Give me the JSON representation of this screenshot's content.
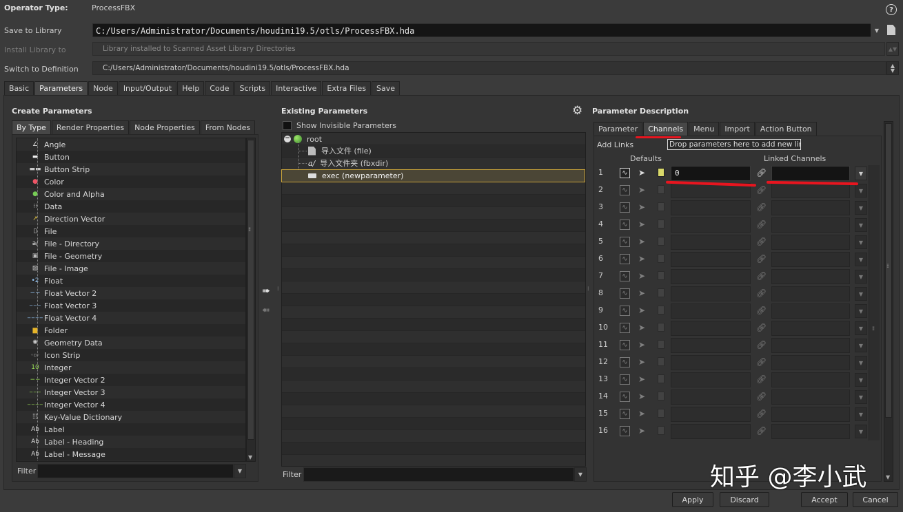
{
  "header": {
    "operator_type_label": "Operator Type:",
    "operator_type_value": "ProcessFBX",
    "save_to_library_label": "Save to Library",
    "save_to_library_value": "C:/Users/Administrator/Documents/houdini19.5/otls/ProcessFBX.hda",
    "install_library_label": "Install Library to",
    "install_library_value": "Library installed to Scanned Asset Library Directories",
    "switch_definition_label": "Switch to Definition",
    "switch_definition_value": "C:/Users/Administrator/Documents/houdini19.5/otls/ProcessFBX.hda",
    "help_icon": "question-circle-icon"
  },
  "main_tabs": [
    "Basic",
    "Parameters",
    "Node",
    "Input/Output",
    "Help",
    "Code",
    "Scripts",
    "Interactive",
    "Extra Files",
    "Save"
  ],
  "main_tab_active": "Parameters",
  "create_parameters": {
    "title": "Create Parameters",
    "tabs": [
      "By Type",
      "Render Properties",
      "Node Properties",
      "From Nodes"
    ],
    "active_tab": "By Type",
    "items": [
      {
        "label": "Angle",
        "icon": "angle-icon"
      },
      {
        "label": "Button",
        "icon": "button-icon"
      },
      {
        "label": "Button Strip",
        "icon": "button-strip-icon"
      },
      {
        "label": "Color",
        "icon": "color-icon"
      },
      {
        "label": "Color and Alpha",
        "icon": "color-alpha-icon"
      },
      {
        "label": "Data",
        "icon": "data-icon"
      },
      {
        "label": "Direction Vector",
        "icon": "direction-vector-icon"
      },
      {
        "label": "File",
        "icon": "file-icon"
      },
      {
        "label": "File - Directory",
        "icon": "directory-icon"
      },
      {
        "label": "File - Geometry",
        "icon": "geometry-file-icon"
      },
      {
        "label": "File - Image",
        "icon": "image-file-icon"
      },
      {
        "label": "Float",
        "icon": "float-icon"
      },
      {
        "label": "Float Vector 2",
        "icon": "float-vector2-icon"
      },
      {
        "label": "Float Vector 3",
        "icon": "float-vector3-icon"
      },
      {
        "label": "Float Vector 4",
        "icon": "float-vector4-icon"
      },
      {
        "label": "Folder",
        "icon": "folder-icon"
      },
      {
        "label": "Geometry Data",
        "icon": "geometry-data-icon"
      },
      {
        "label": "Icon Strip",
        "icon": "icon-strip-icon"
      },
      {
        "label": "Integer",
        "icon": "integer-icon"
      },
      {
        "label": "Integer Vector 2",
        "icon": "integer-vector2-icon"
      },
      {
        "label": "Integer Vector 3",
        "icon": "integer-vector3-icon"
      },
      {
        "label": "Integer Vector 4",
        "icon": "integer-vector4-icon"
      },
      {
        "label": "Key-Value Dictionary",
        "icon": "dictionary-icon"
      },
      {
        "label": "Label",
        "icon": "label-icon"
      },
      {
        "label": "Label - Heading",
        "icon": "label-heading-icon"
      },
      {
        "label": "Label - Message",
        "icon": "label-message-icon"
      }
    ],
    "filter_label": "Filter"
  },
  "existing_parameters": {
    "title": "Existing Parameters",
    "show_invisible_label": "Show Invisible Parameters",
    "root_label": "root",
    "children": [
      {
        "label": "导入文件 (file)",
        "icon": "geometry-file-icon"
      },
      {
        "label": "导入文件夹 (fbxdir)",
        "icon": "directory-icon"
      },
      {
        "label": "exec (newparameter)",
        "icon": "button-icon"
      }
    ],
    "selected_index": 2,
    "filter_label": "Filter"
  },
  "parameter_description": {
    "title": "Parameter Description",
    "tabs": [
      "Parameter",
      "Channels",
      "Menu",
      "Import",
      "Action Button"
    ],
    "active_tab": "Channels",
    "add_links_label": "Add Links",
    "drop_hint": "Drop parameters here to add new links",
    "defaults_label": "Defaults",
    "linked_channels_label": "Linked Channels",
    "rows": [
      "1",
      "2",
      "3",
      "4",
      "5",
      "6",
      "7",
      "8",
      "9",
      "10",
      "11",
      "12",
      "13",
      "14",
      "15",
      "16"
    ],
    "first_default_value": "0"
  },
  "footer": {
    "apply": "Apply",
    "discard": "Discard",
    "accept": "Accept",
    "cancel": "Cancel"
  },
  "watermark": "知乎 @李小武",
  "colors": {
    "accent_highlight": "#e8151f",
    "selection_border": "#c8a23a"
  }
}
